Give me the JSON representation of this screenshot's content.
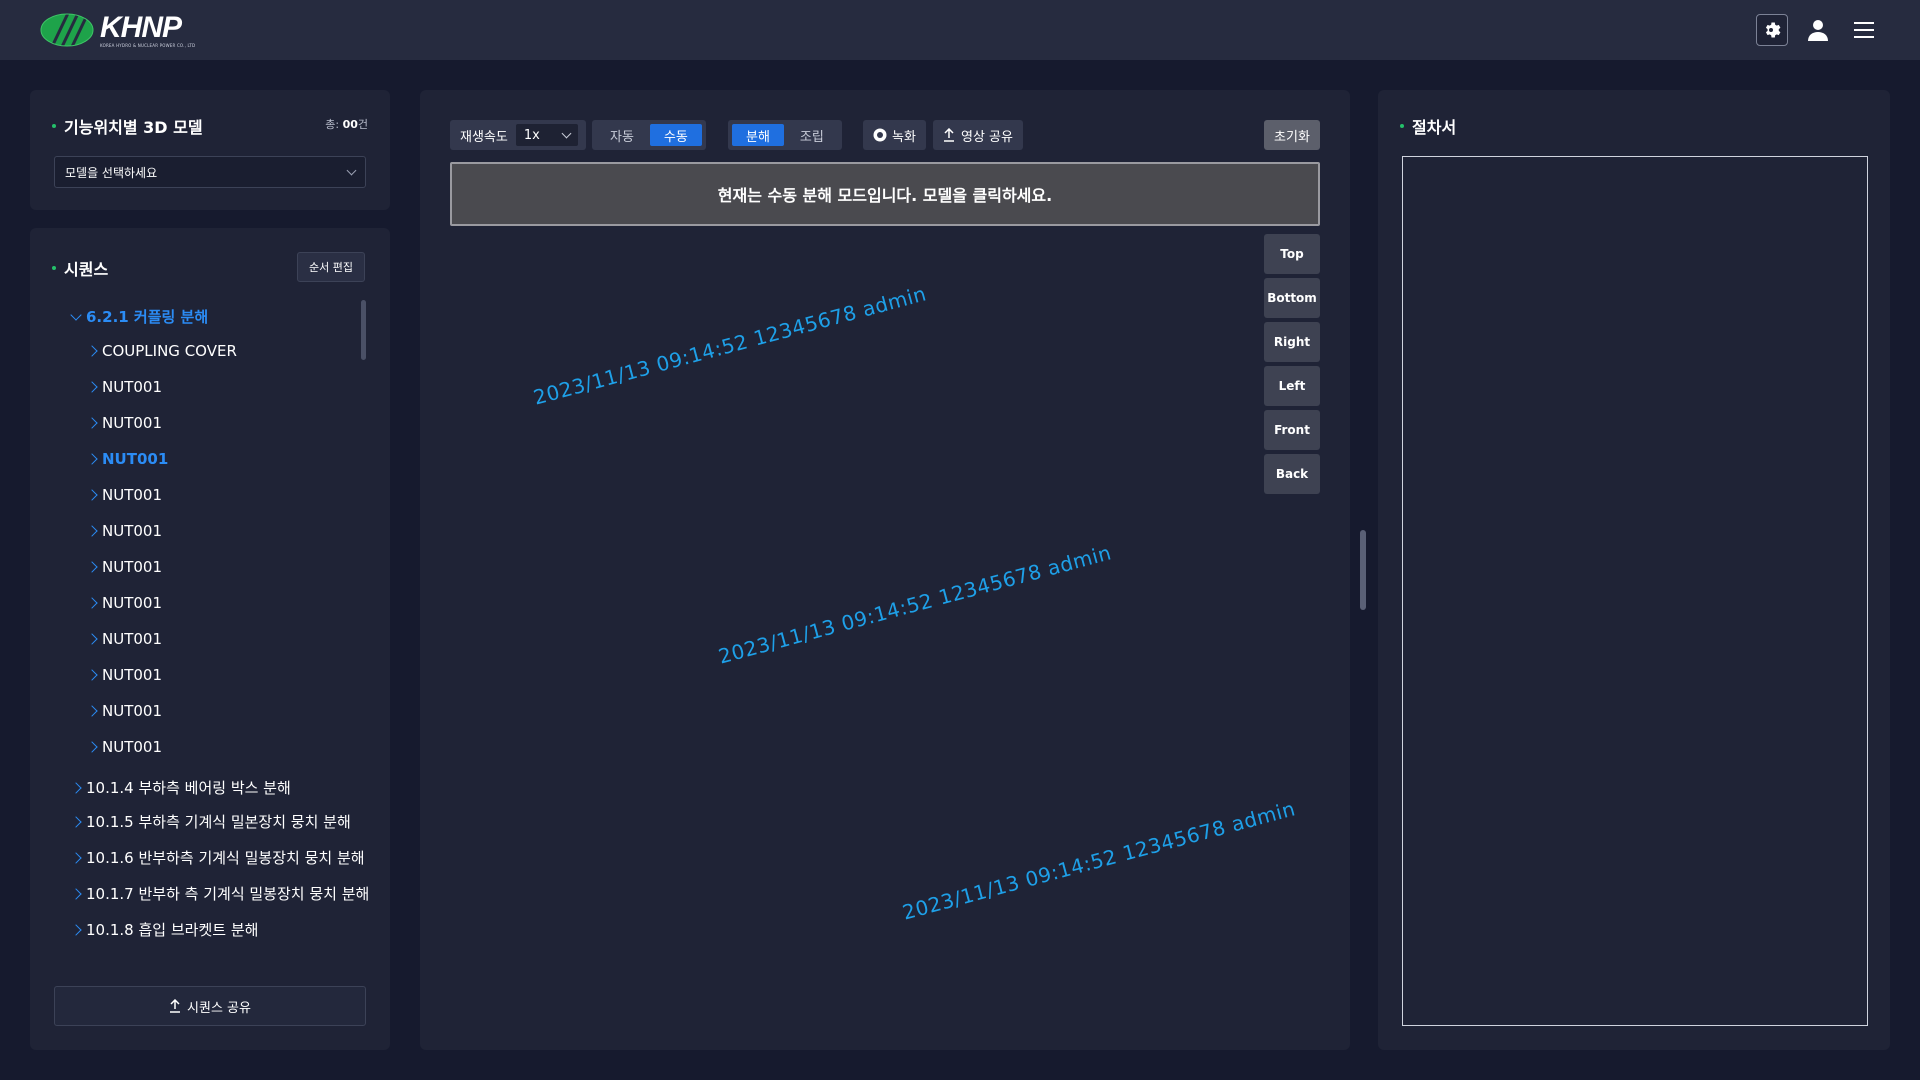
{
  "header": {
    "logo_text": "KHNP",
    "logo_subtext": "KOREA HYDRO & NUCLEAR POWER CO., LTD",
    "icons": [
      "gear-icon",
      "user-icon",
      "hamburger-menu-icon"
    ]
  },
  "model_panel": {
    "title": "기능위치별 3D 모델",
    "total_prefix": "총: ",
    "total_value": "00",
    "total_suffix": "건",
    "select_placeholder": "모델을 선택하세요"
  },
  "sequence_panel": {
    "title": "시퀀스",
    "edit_order_label": "순서 편집",
    "group_label": "6.2.1 커플링 분해",
    "children": [
      {
        "label": "COUPLING COVER",
        "active": false
      },
      {
        "label": "NUT001",
        "active": false
      },
      {
        "label": "NUT001",
        "active": false
      },
      {
        "label": "NUT001",
        "active": true
      },
      {
        "label": "NUT001",
        "active": false
      },
      {
        "label": "NUT001",
        "active": false
      },
      {
        "label": "NUT001",
        "active": false
      },
      {
        "label": "NUT001",
        "active": false
      },
      {
        "label": "NUT001",
        "active": false
      },
      {
        "label": "NUT001",
        "active": false
      },
      {
        "label": "NUT001",
        "active": false
      },
      {
        "label": "NUT001",
        "active": false
      }
    ],
    "groups": [
      "10.1.4 부하측 베어링 박스 분해",
      "10.1.5 부하측 기계식 밀본장치 뭉치 분해",
      "10.1.6 반부하측 기계식 밀봉장치 뭉치 분해",
      "10.1.7 반부하 측 기계식 밀봉장치 뭉치 분해",
      "10.1.8 흡입 브라켓트 분해"
    ],
    "share_label": "시퀀스 공유"
  },
  "toolbar": {
    "speed_label": "재생속도",
    "speed_value": "1x",
    "mode_auto": "자동",
    "mode_manual": "수동",
    "disassemble": "분해",
    "assemble": "조립",
    "record": "녹화",
    "share_video": "영상 공유",
    "reset": "초기화"
  },
  "viewer": {
    "banner": "현재는 수동 분해 모드입니다.  모델을 클릭하세요.",
    "views": [
      "Top",
      "Bottom",
      "Right",
      "Left",
      "Front",
      "Back"
    ],
    "watermark": "2023/11/13 09:14:52 12345678 admin"
  },
  "procedure_panel": {
    "title": "절차서"
  },
  "colors": {
    "accent_blue": "#1f6fe0",
    "active_text": "#2b8cf5",
    "watermark": "#1ea0e8",
    "title_dot": "#24c06a"
  }
}
